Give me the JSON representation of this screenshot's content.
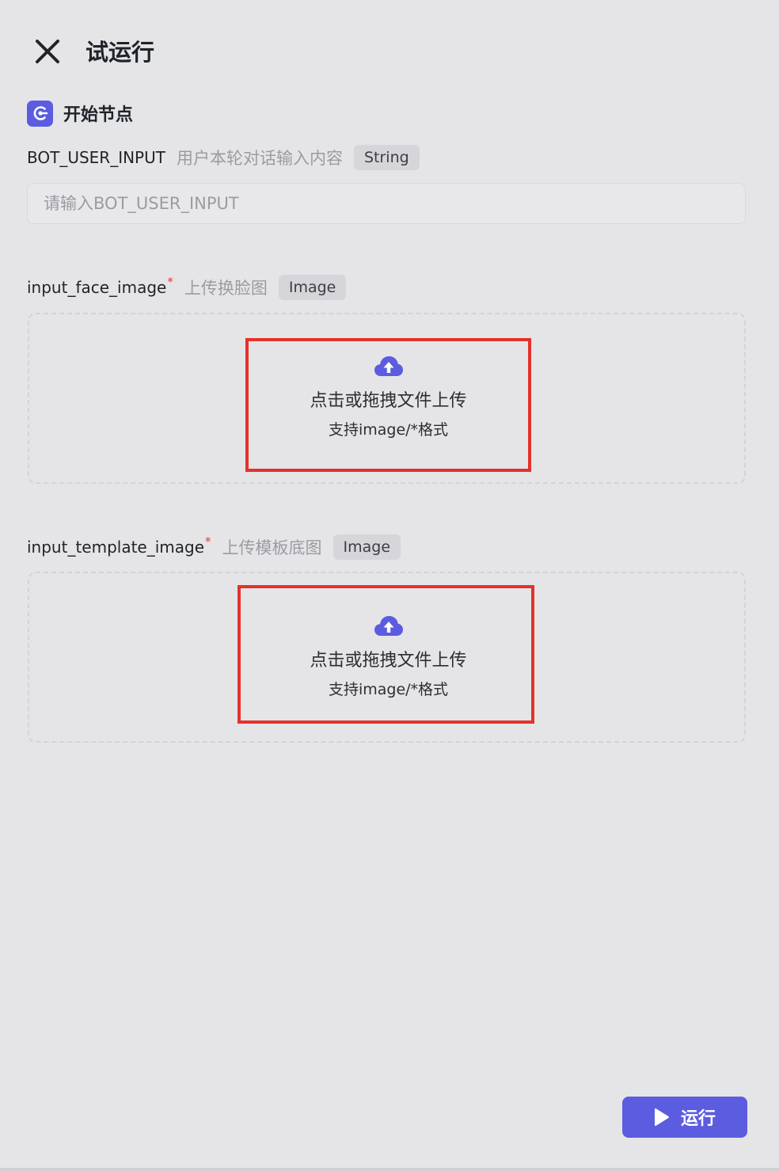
{
  "header": {
    "title": "试运行",
    "close_icon": "close-icon"
  },
  "node": {
    "title": "开始节点",
    "icon": "start-node-icon",
    "icon_color": "#5b5ce0"
  },
  "fields": {
    "bot_user_input": {
      "name": "BOT_USER_INPUT",
      "description": "用户本轮对话输入内容",
      "type": "String",
      "placeholder": "请输入BOT_USER_INPUT",
      "value": ""
    },
    "input_face_image": {
      "name": "input_face_image",
      "required": "*",
      "description": "上传换脸图",
      "type": "Image",
      "upload_text": "点击或拖拽文件上传",
      "upload_hint": "支持image/*格式"
    },
    "input_template_image": {
      "name": "input_template_image",
      "required": "*",
      "description": "上传模板底图",
      "type": "Image",
      "upload_text": "点击或拖拽文件上传",
      "upload_hint": "支持image/*格式"
    }
  },
  "footer": {
    "run_label": "运行",
    "run_icon": "play-icon"
  },
  "colors": {
    "accent": "#5b5ce0",
    "highlight": "#e3322c",
    "background": "#e5e5e8"
  }
}
